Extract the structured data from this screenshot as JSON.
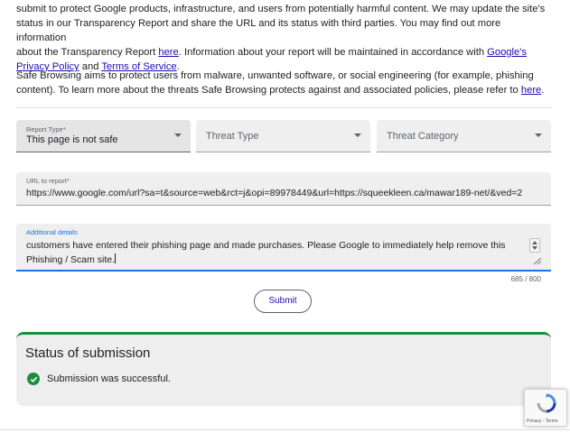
{
  "intro": {
    "line1": "submit to protect Google products, infrastructure, and users from potentially harmful content. We may update the site's",
    "line2": "status in our Transparency Report and share the URL and its status with third parties. You may find out more information",
    "line3_a": "about the Transparency Report ",
    "link_here": "here",
    "line3_b": ". Information about your report will be maintained in accordance with ",
    "link_privacy": "Google's Privacy Policy",
    "and": " and ",
    "link_terms": "Terms of Service",
    "period": "."
  },
  "about": {
    "text_a": "Safe Browsing aims to protect users from malware, unwanted software, or social engineering (for example, phishing content). To learn more about the threats Safe Browsing protects against and associated policies, please refer to ",
    "link_here": "here",
    "period": "."
  },
  "form": {
    "report_type": {
      "label": "Report Type*",
      "value": "This page is not safe"
    },
    "threat_type": {
      "placeholder": "Threat Type"
    },
    "threat_category": {
      "placeholder": "Threat Category"
    },
    "url": {
      "label": "URL to report*",
      "value": "https://www.google.com/url?sa=t&source=web&rct=j&opi=89978449&url=https://squeekleen.ca/mawar189-net/&ved=2"
    },
    "details": {
      "label": "Additional details",
      "line1": "customers have entered their phishing page and made purchases. Please Google to immediately help remove this",
      "line2": "Phishing / Scam site."
    },
    "counter": "685 / 800",
    "submit_label": "Submit"
  },
  "status": {
    "title": "Status of submission",
    "message": "Submission was successful."
  },
  "recaptcha": {
    "links": "Privacy - Terms"
  },
  "colors": {
    "accent": "#1a73e8",
    "success": "#1e8e3e",
    "link": "#1a0dab"
  }
}
